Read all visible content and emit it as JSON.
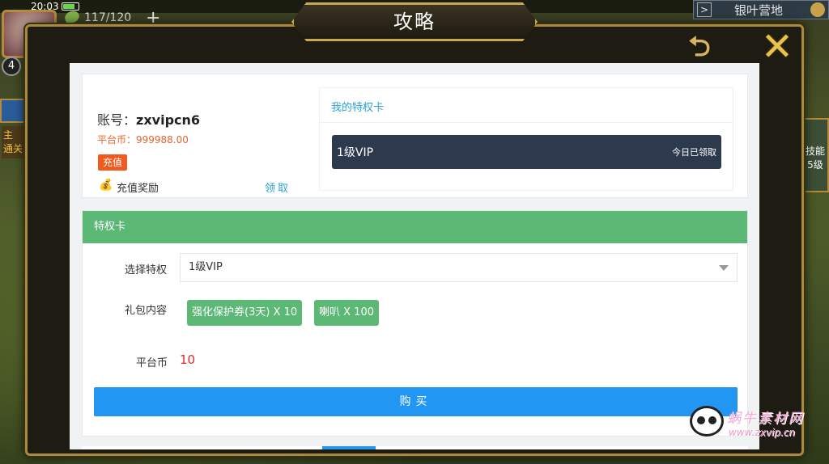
{
  "status_bar": {
    "time": "20:03"
  },
  "hud": {
    "level": "4",
    "stamina": "117/120",
    "plus": "+",
    "camp_label": "银叶营地",
    "camp_arrow": ">",
    "side_left_text": "主\n通关",
    "side_right_text": "技能\n5级",
    "icons": [
      "avatar-icon",
      "stamina-leaf-icon",
      "gear-icon"
    ]
  },
  "dialog": {
    "title": "攻略",
    "back_icon": "back-arrow-icon",
    "close_icon": "close-x-icon",
    "back_glyph": "⮌",
    "close_glyph": "✕"
  },
  "account": {
    "id_label": "账号：",
    "id_value": "zxvipcn6",
    "platform_coin": "平台币：999988.00",
    "recharge_label": "充值",
    "reward_icon": "money-bag-icon",
    "reward_glyph": "💰",
    "reward_label": "充值奖励",
    "reward_claim": "领取"
  },
  "my_cards": {
    "title": "我的特权卡",
    "vip_name": "1级VIP",
    "vip_status": "今日已领取"
  },
  "privilege": {
    "header": "特权卡",
    "select_label": "选择特权",
    "select_value": "1级VIP",
    "gift_label": "礼包内容",
    "gifts": [
      "强化保护券(3天) X 10",
      "喇叭 X 100"
    ],
    "coin_label": "平台币",
    "coin_value": "10",
    "buy_label": "购买"
  },
  "watermark": {
    "line1": "蜗牛素材网",
    "line2": "www.zxvip.cn"
  },
  "colors": {
    "green": "#5cb875",
    "blue": "#2196f3",
    "dark_card": "#2d3a4d",
    "orange": "#f05a1e",
    "red": "#e32626",
    "gold": "#c9a84a"
  }
}
